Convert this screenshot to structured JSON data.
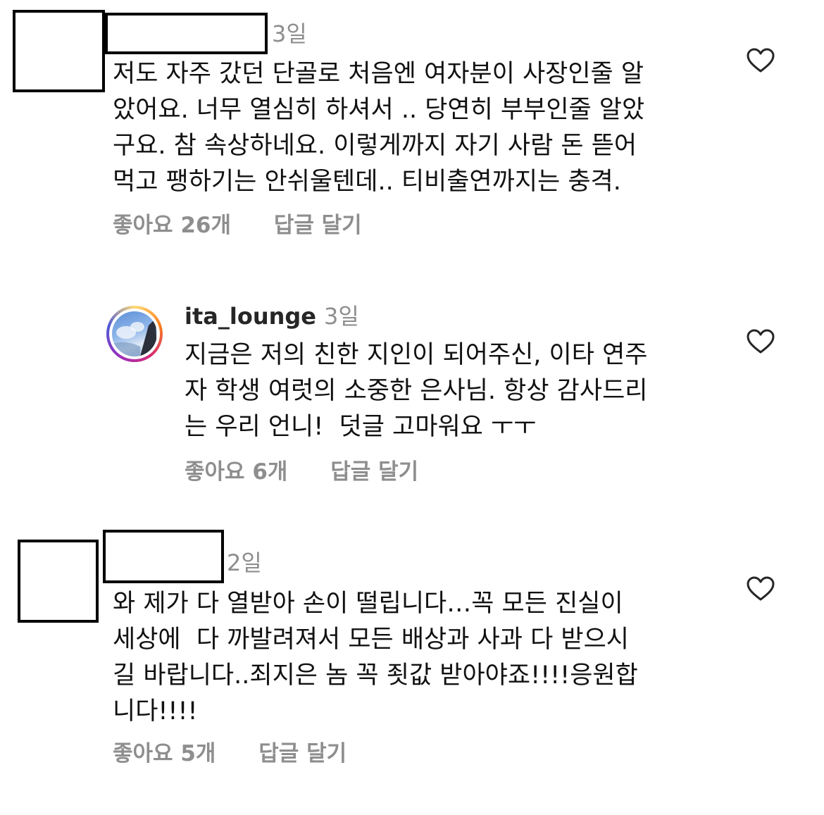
{
  "comments": [
    {
      "username": "",
      "time": "3일",
      "text": "저도 자주 갔던 단골로 처음엔 여자분이 사장인줄 알\n았어요. 너무 열심히 하셔서 .. 당연히 부부인줄 알았\n구요. 참 속상하네요. 이렇게까지 자기 사람 돈 뜯어\n먹고 팽하기는 안쉬울텐데.. 티비출연까지는 충격.",
      "likes": "좋아요 26개",
      "reply": "답글 달기",
      "like_icon": "heart-outline-icon"
    },
    {
      "username": "ita_lounge",
      "time": "3일",
      "text": "지금은 저의 친한 지인이 되어주신, 이타 연주\n자 학생 여럿의 소중한 은사님. 항상 감사드리\n는 우리 언니!  덧글 고마워요 ㅜㅜ",
      "likes": "좋아요 6개",
      "reply": "답글 달기",
      "like_icon": "heart-outline-icon"
    },
    {
      "username": "",
      "time": "2일",
      "text": "와 제가 다 열받아 손이 떨립니다…꼭 모든 진실이\n세상에  다 까발려져서 모든 배상과 사과 다 받으시\n길 바랍니다..죄지은 놈 꼭 죗값 받아야죠!!!!응원합\n니다!!!!",
      "likes": "좋아요 5개",
      "reply": "답글 달기",
      "like_icon": "heart-outline-icon"
    }
  ],
  "colors": {
    "text": "#111111",
    "muted": "#8e8e8e",
    "redaction_border": "#000000"
  }
}
